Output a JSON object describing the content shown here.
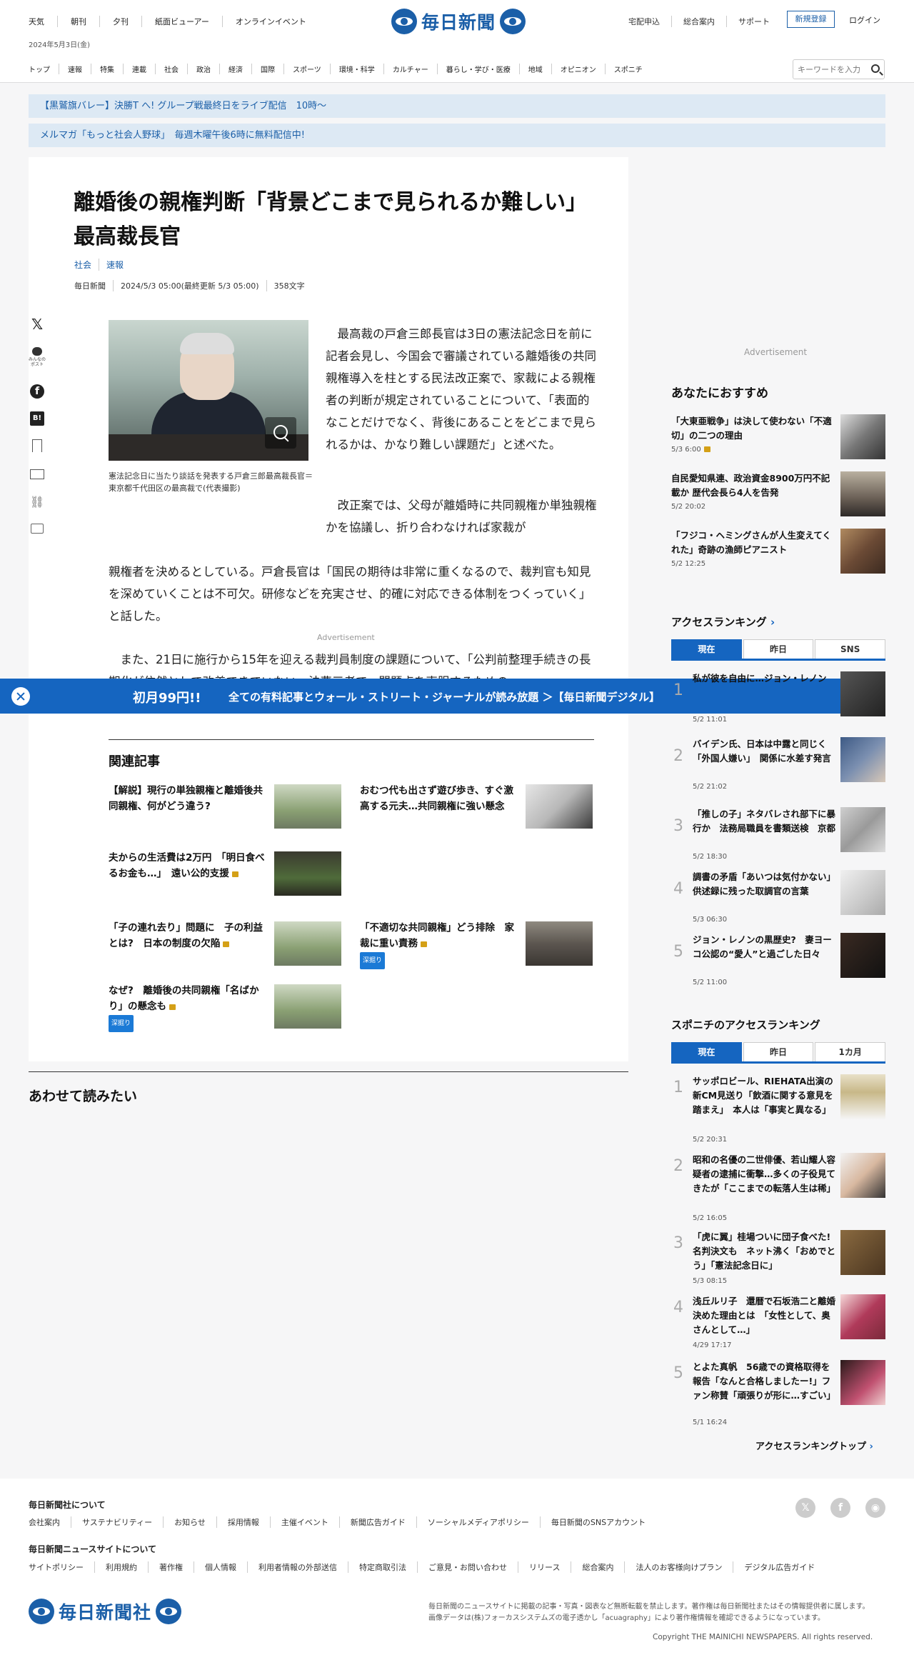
{
  "header": {
    "top_links": [
      "天気",
      "朝刊",
      "夕刊",
      "紙面ビューアー",
      "オンラインイベント"
    ],
    "date": "2024年5月3日(金)",
    "logo_text": "毎日新聞",
    "right_links": [
      "宅配申込",
      "総合案内",
      "サポート"
    ],
    "register_label": "新規登録",
    "login_label": "ログイン",
    "nav": [
      "トップ",
      "速報",
      "特集",
      "連載",
      "社会",
      "政治",
      "経済",
      "国際",
      "スポーツ",
      "環境・科学",
      "カルチャー",
      "暮らし・学び・医療",
      "地域",
      "オピニオン",
      "スポニチ"
    ],
    "search_placeholder": "キーワードを入力"
  },
  "announcements": [
    "【黒鷲旗バレー】決勝T へ! グループ戦最終日をライブ配信　10時～",
    "メルマガ「もっと社会人野球」　毎週木曜午後6時に無料配信中!"
  ],
  "article": {
    "title_line1": "離婚後の親権判断「背景どこまで見られるか難しい」",
    "title_line2": "最高裁長官",
    "categories": [
      "社会",
      "速報"
    ],
    "meta": [
      "毎日新聞",
      "2024/5/3 05:00(最終更新 5/3 05:00)",
      "358文字"
    ],
    "share": {
      "remark_label": "みんなの\nポスト"
    },
    "caption": "憲法記念日に当たり談話を発表する戸倉三郎最高裁長官＝東京都千代田区の最高裁で(代表撮影)",
    "para1": "　最高裁の戸倉三郎長官は3日の憲法記念日を前に記者会見し、今国会で審議されている離婚後の共同親権導入を柱とする民法改正案で、家裁による親権者の判断が規定されていることについて、「表面的なことだけでなく、背後にあることをどこまで見られるかは、かなり難しい課題だ」と述べた。",
    "para2_wrap": "　改正案では、父母が離婚時に共同親権か単独親権かを協議し、折り合わなければ家裁が",
    "para2_full": "親権者を決めるとしている。戸倉長官は「国民の期待は非常に重くなるので、裁判官も知見を深めていくことは不可欠。研修などを充実させ、的確に対応できる体制をつくっていく」と話した。",
    "ad_label": "Advertisement",
    "para3": "　また、21日に施行から15年を迎える裁判員制度の課題について、「公判前整理手続きの長期化が依然として改善できていない。法曹三者で、問題点を克服するための"
  },
  "promo": {
    "price": "初月99円!!",
    "text": "全ての有料記事とウォール・ストリート・ジャーナルが読み放題 ＞【毎日新聞デジタル】"
  },
  "related": {
    "heading": "関連記事",
    "items": [
      {
        "title": "【解説】現行の単独親権と離婚後共同親権、何がどう違う?",
        "locked": false,
        "tag": ""
      },
      {
        "title": "おむつ代も出さず遊び歩き、すぐ激高する元夫…共同親権に強い懸念",
        "locked": false,
        "tag": ""
      },
      {
        "title": "夫からの生活費は2万円　「明日食べるお金も…」　遠い公的支援",
        "locked": true,
        "tag": ""
      },
      {
        "title": "「子の連れ去り」問題に　子の利益とは?　日本の制度の欠陥",
        "locked": true,
        "tag": ""
      },
      {
        "title": "「不適切な共同親権」どう排除　家裁に重い責務",
        "locked": true,
        "tag": "深掘り"
      },
      {
        "title": "なぜ?　離婚後の共同親権「名ばかり」の懸念も",
        "locked": true,
        "tag": "深掘り"
      }
    ]
  },
  "also_read": {
    "heading": "あわせて読みたい"
  },
  "sidebar": {
    "ad_label": "Advertisement",
    "recommend_heading": "あなたにおすすめ",
    "recommend": [
      {
        "title": "「大東亜戦争」は決して使わない「不適切」の二つの理由",
        "date": "5/3 6:00",
        "locked": true
      },
      {
        "title": "自民愛知県連、政治資金8900万円不記載か 歴代会長ら4人を告発",
        "date": "5/2 20:02",
        "locked": false
      },
      {
        "title": "「フジコ・ヘミングさんが人生変えてくれた」奇跡の漁師ピアニスト",
        "date": "5/2 12:25",
        "locked": false
      }
    ],
    "ranking_heading": "アクセスランキング",
    "ranking_tabs": [
      "現在",
      "昨日",
      "SNS"
    ],
    "ranking": [
      {
        "rank": "1",
        "title": "私が彼を自由に…ジョン・レノン",
        "date": "5/2 11:01"
      },
      {
        "rank": "2",
        "title": "バイデン氏、日本は中露と同じく「外国人嫌い」　関係に水差す発言",
        "date": "5/2 21:02"
      },
      {
        "rank": "3",
        "title": "「推しの子」ネタバレされ部下に暴行か　法務局職員を書類送検　京都",
        "date": "5/2 18:30"
      },
      {
        "rank": "4",
        "title": "調書の矛盾「あいつは気付かない」　供述録に残った取調官の言葉",
        "date": "5/3 06:30"
      },
      {
        "rank": "5",
        "title": "ジョン・レノンの黒歴史?　妻ヨーコ公認の“愛人”と過ごした日々",
        "date": "5/2 11:00"
      }
    ],
    "sponichi_heading": "スポニチのアクセスランキング",
    "sponichi_tabs": [
      "現在",
      "昨日",
      "1カ月"
    ],
    "sponichi": [
      {
        "rank": "1",
        "title": "サッポロビール、RIEHATA出演の新CM見送り「飲酒に関する意見を踏まえ」　本人は「事実と異なる」",
        "date": "5/2 20:31"
      },
      {
        "rank": "2",
        "title": "昭和の名優の二世俳優、若山耀人容疑者の逮捕に衝撃…多くの子役見てきたが「ここまでの転落人生は稀」",
        "date": "5/2 16:05"
      },
      {
        "rank": "3",
        "title": "「虎に翼」桂場ついに団子食べた!名判決文も　ネット沸く「おめでとう」「憲法記念日に」",
        "date": "5/3 08:15"
      },
      {
        "rank": "4",
        "title": "浅丘ルリ子　還暦で石坂浩二と離婚決めた理由とは　「女性として、奥さんとして…」",
        "date": "4/29 17:17"
      },
      {
        "rank": "5",
        "title": "とよた真帆　56歳での資格取得を報告「なんと合格しましたー!」ファン称賛「頑張りが形に…すごい」",
        "date": "5/1 16:24"
      }
    ],
    "ranking_top_link": "アクセスランキングトップ"
  },
  "footer": {
    "about_heading": "毎日新聞社について",
    "about_links": [
      "会社案内",
      "サステナビリティー",
      "お知らせ",
      "採用情報",
      "主催イベント",
      "新聞広告ガイド",
      "ソーシャルメディアポリシー",
      "毎日新聞のSNSアカウント"
    ],
    "site_heading": "毎日新聞ニュースサイトについて",
    "site_links": [
      "サイトポリシー",
      "利用規約",
      "著作権",
      "個人情報",
      "利用者情報の外部送信",
      "特定商取引法",
      "ご意見・お問い合わせ",
      "リリース",
      "総合案内",
      "法人のお客様向けプラン",
      "デジタル広告ガイド"
    ],
    "logo_text": "毎日新聞社",
    "note1": "毎日新聞のニュースサイトに掲載の記事・写真・図表など無断転載を禁止します。著作権は毎日新聞社またはその情報提供者に属します。",
    "note2": "画像データは(株)フォーカスシステムズの電子透かし「acuagraphy」により著作権情報を確認できるようになっています。",
    "copyright": "Copyright THE MAINICHI NEWSPAPERS. All rights reserved."
  }
}
